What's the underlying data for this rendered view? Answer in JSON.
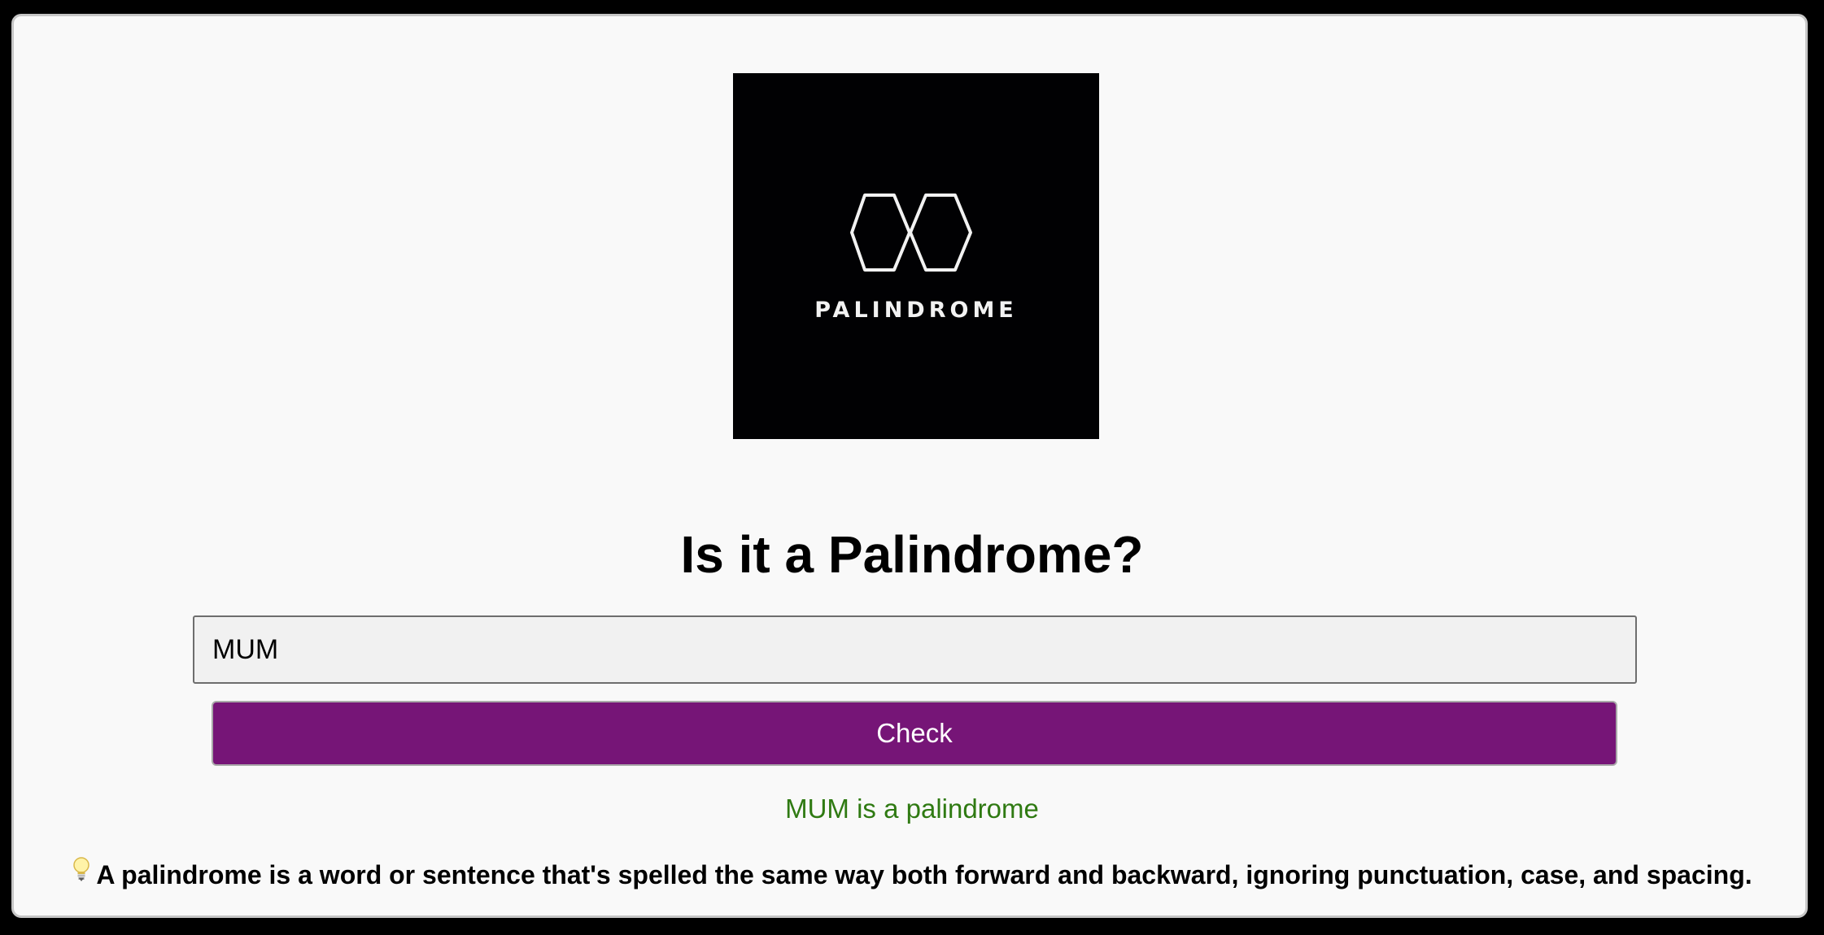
{
  "logo": {
    "text": "PALINDROME",
    "icon": "interlocking-hexagons-icon",
    "background": "#010103"
  },
  "page": {
    "title": "Is it a Palindrome?"
  },
  "form": {
    "input_value": "MUM",
    "placeholder": "",
    "button_label": "Check",
    "button_color": "#761577"
  },
  "result": {
    "text": "MUM is a palindrome",
    "color": "#2f7a12"
  },
  "info": {
    "icon": "lightbulb-icon",
    "text": "A palindrome is a word or sentence that's spelled the same way both forward and backward, ignoring punctuation, case, and spacing."
  }
}
